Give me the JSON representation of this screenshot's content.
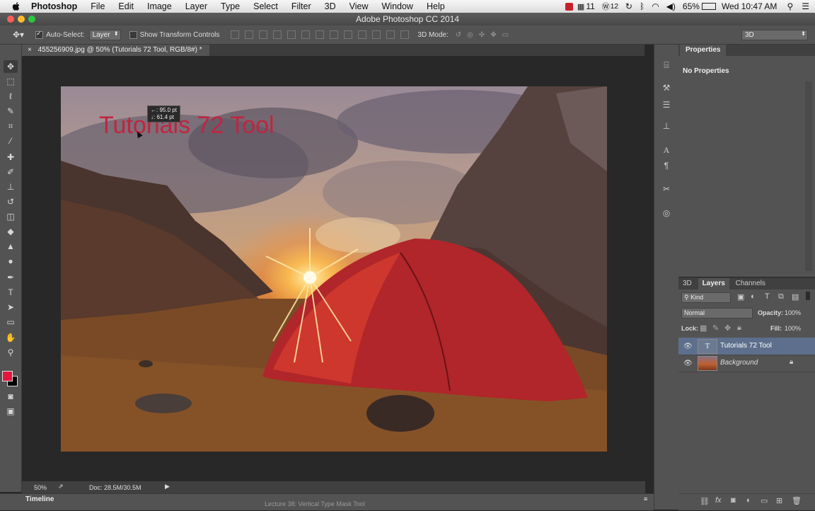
{
  "menubar": {
    "items": [
      "Photoshop",
      "File",
      "Edit",
      "Image",
      "Layer",
      "Type",
      "Select",
      "Filter",
      "3D",
      "View",
      "Window",
      "Help"
    ],
    "status": {
      "badge_count": "11",
      "badge_count2": "12",
      "battery": "65%",
      "clock": "Wed 10:47 AM"
    }
  },
  "window": {
    "title": "Adobe Photoshop CC 2014"
  },
  "options_bar": {
    "auto_select_label": "Auto-Select:",
    "auto_select_value": "Layer",
    "transform_label": "Show Transform Controls",
    "mode_label": "3D Mode:",
    "workspace": "3D"
  },
  "document": {
    "tab_title": "455256909.jpg @ 50% (Tutorials 72 Tool, RGB/8#) *",
    "canvas_text": "Tutorials 72 Tool",
    "tooltip_line1": "←: 95.0 pt",
    "tooltip_line2": "↓: 61.4 pt",
    "text_color": "#c0253f"
  },
  "status": {
    "zoom": "50%",
    "doc_size": "Doc: 28.5M/30.5M"
  },
  "timeline": {
    "label": "Timeline",
    "behind_text": "Lecture 38: Vertical Type Mask Tool"
  },
  "properties": {
    "title": "Properties",
    "empty_text": "No Properties"
  },
  "layers_panel": {
    "tabs": [
      "3D",
      "Layers",
      "Channels"
    ],
    "filter_label": "Kind",
    "blend_mode": "Normal",
    "opacity_label": "Opacity:",
    "opacity_value": "100%",
    "lock_label": "Lock:",
    "fill_label": "Fill:",
    "fill_value": "100%",
    "layers": [
      {
        "name": "Tutorials 72 Tool",
        "type_glyph": "T",
        "selected": true
      },
      {
        "name": "Background",
        "locked": true
      }
    ]
  },
  "foreground_color": "#e3173e"
}
